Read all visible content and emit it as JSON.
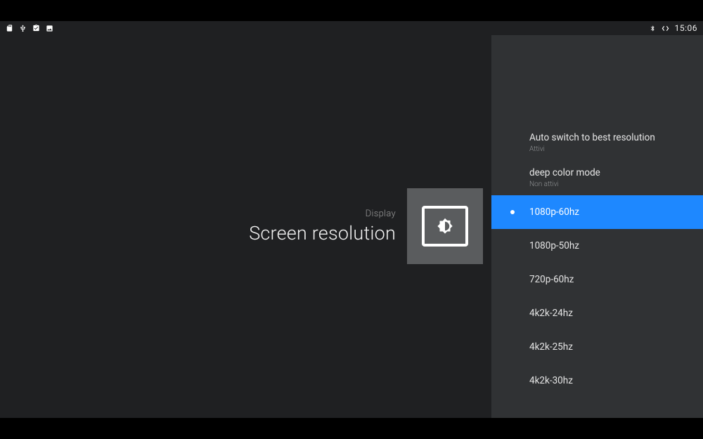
{
  "status": {
    "clock": "15:06"
  },
  "hero": {
    "category": "Display",
    "title": "Screen resolution"
  },
  "settings": [
    {
      "primary": "Auto switch to best resolution",
      "secondary": "Attivi"
    },
    {
      "primary": "deep color mode",
      "secondary": "Non attivi"
    }
  ],
  "resolutions": [
    {
      "label": "1080p-60hz",
      "selected": true
    },
    {
      "label": "1080p-50hz",
      "selected": false
    },
    {
      "label": "720p-60hz",
      "selected": false
    },
    {
      "label": "4k2k-24hz",
      "selected": false
    },
    {
      "label": "4k2k-25hz",
      "selected": false
    },
    {
      "label": "4k2k-30hz",
      "selected": false
    }
  ],
  "colors": {
    "accent": "#1e88ff",
    "panel": "#303234",
    "bg": "#1f2022"
  }
}
